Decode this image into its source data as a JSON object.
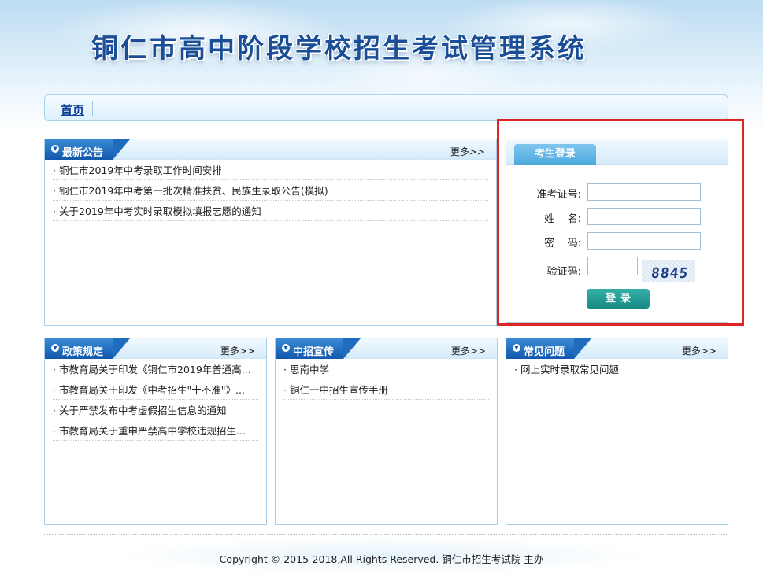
{
  "site": {
    "title": "铜仁市高中阶段学校招生考试管理系统"
  },
  "nav": {
    "home": "首页"
  },
  "panels": {
    "announcements": {
      "title": "最新公告",
      "more": "更多>>",
      "items": [
        "铜仁市2019年中考录取工作时间安排",
        "铜仁市2019年中考第一批次精准扶贫、民族生录取公告(模拟)",
        "关于2019年中考实时录取模拟填报志愿的通知"
      ]
    },
    "policy": {
      "title": "政策规定",
      "more": "更多>>",
      "items": [
        "市教育局关于印发《铜仁市2019年普通高...",
        "市教育局关于印发《中考招生\"十不准\"》...",
        "关于严禁发布中考虚假招生信息的通知",
        "市教育局关于重申严禁高中学校违规招生..."
      ]
    },
    "promo": {
      "title": "中招宣传",
      "more": "更多>>",
      "items": [
        "思南中学",
        "铜仁一中招生宣传手册"
      ]
    },
    "faq": {
      "title": "常见问题",
      "more": "更多>>",
      "items": [
        "网上实时录取常见问题"
      ]
    }
  },
  "login": {
    "title": "考生登录",
    "exam_id_label": "准考证号:",
    "name_label": "姓    名:",
    "password_label": "密    码:",
    "captcha_label": "验证码:",
    "exam_id_value": "",
    "name_value": "",
    "password_value": "",
    "captcha_value": "",
    "captcha_code": "8845",
    "submit": "登录"
  },
  "footer": {
    "copyright": "Copyright © 2015-2018,All Rights Reserved. 铜仁市招生考试院 主办"
  },
  "colors": {
    "accent": "#1258ad",
    "highlight_border": "#e02323",
    "login_button": "#158a82"
  }
}
